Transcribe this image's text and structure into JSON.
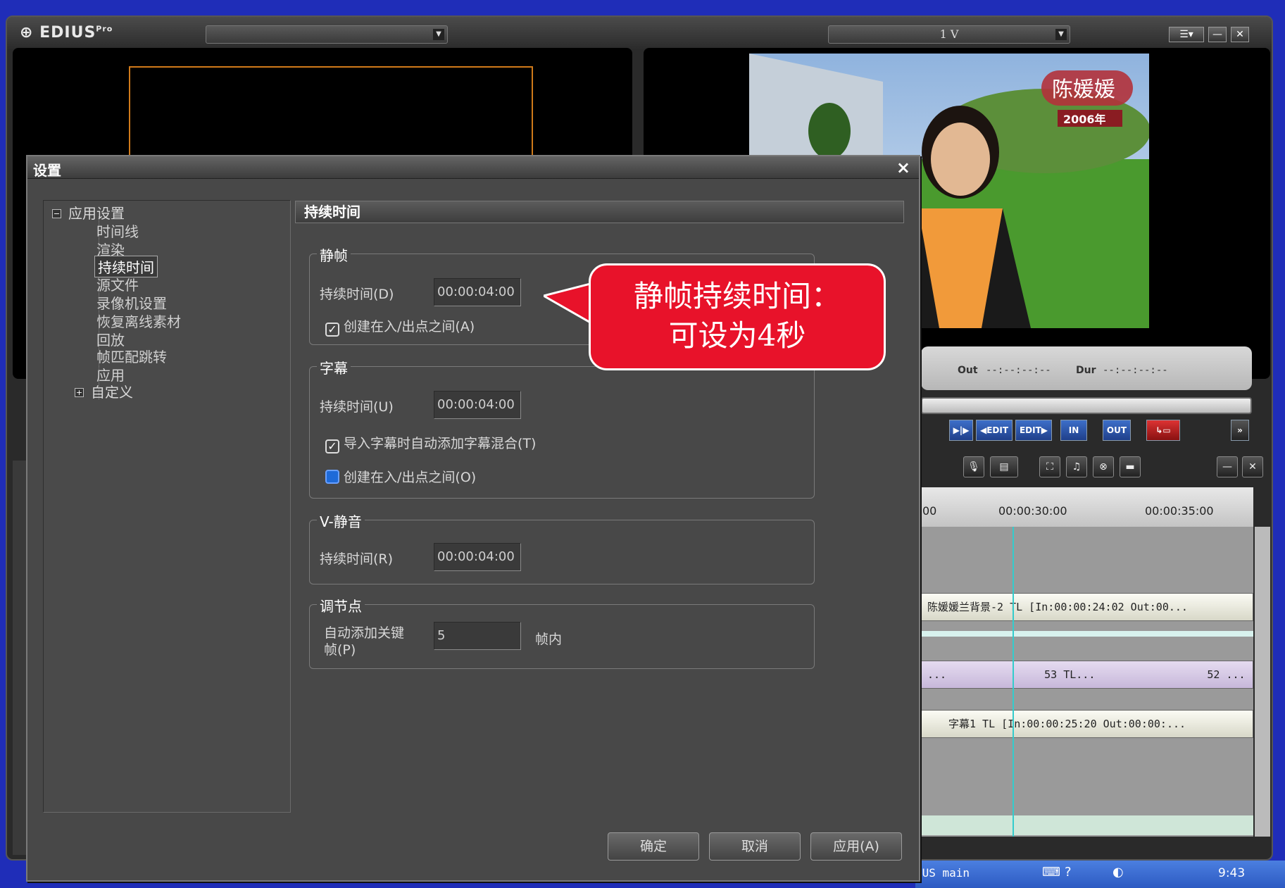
{
  "app": {
    "name": "EDIUS",
    "edition": "Pro",
    "source_dropdown": "",
    "record_dropdown": "1 V"
  },
  "record_monitor": {
    "overlay_name": "陈媛媛",
    "overlay_year": "2006年"
  },
  "timecode": {
    "out_label": "Out",
    "out_value": "--:--:--:--",
    "dur_label": "Dur",
    "dur_value": "--:--:--:--"
  },
  "transport": {
    "edit_in": "◀EDIT",
    "edit_out": "EDIT▶",
    "in": "IN",
    "out": "OUT"
  },
  "timeline": {
    "ruler_left": "00",
    "ruler_mid": "00:00:30:00",
    "ruler_right": "00:00:35:00",
    "clip_v2": "陈媛媛兰背景-2 TL [In:00:00:24:02 Out:00...",
    "clip_v1_a": "...",
    "clip_v1_b": "53 TL...",
    "clip_v1_c": "52 ...",
    "clip_title": "字幕1 TL [In:00:00:25:20 Out:00:00:..."
  },
  "taskbar": {
    "task_label": "IUS main",
    "clock": "9:43"
  },
  "dialog": {
    "title": "设置",
    "close_label": "×",
    "tree": {
      "root": "应用设置",
      "children": [
        "时间线",
        "渲染",
        "持续时间",
        "源文件",
        "录像机设置",
        "恢复离线素材",
        "回放",
        "帧匹配跳转",
        "应用"
      ],
      "selected": "持续时间",
      "custom": "自定义"
    },
    "panel_title": "持续时间",
    "still": {
      "group": "静帧",
      "duration_label": "持续时间(D)",
      "duration_value": "00:00:04:00",
      "checkbox_label": "创建在入/出点之间(A)",
      "checked": true
    },
    "title_group": {
      "group": "字幕",
      "duration_label": "持续时间(U)",
      "duration_value": "00:00:04:00",
      "auto_mix_label": "导入字幕时自动添加字幕混合(T)",
      "auto_mix_checked": true,
      "inout_label": "创建在入/出点之间(O)",
      "inout_checked": false
    },
    "vmute": {
      "group": "V-静音",
      "duration_label": "持续时间(R)",
      "duration_value": "00:00:04:00"
    },
    "keyframe": {
      "group": "调节点",
      "label_line1": "自动添加关键",
      "label_line2": "帧(P)",
      "value": "5",
      "unit": "帧内"
    },
    "buttons": {
      "ok": "确定",
      "cancel": "取消",
      "apply": "应用(A)"
    }
  },
  "callout": {
    "line1": "静帧持续时间：",
    "line2": "可设为4秒",
    "color": "#e8122a"
  }
}
